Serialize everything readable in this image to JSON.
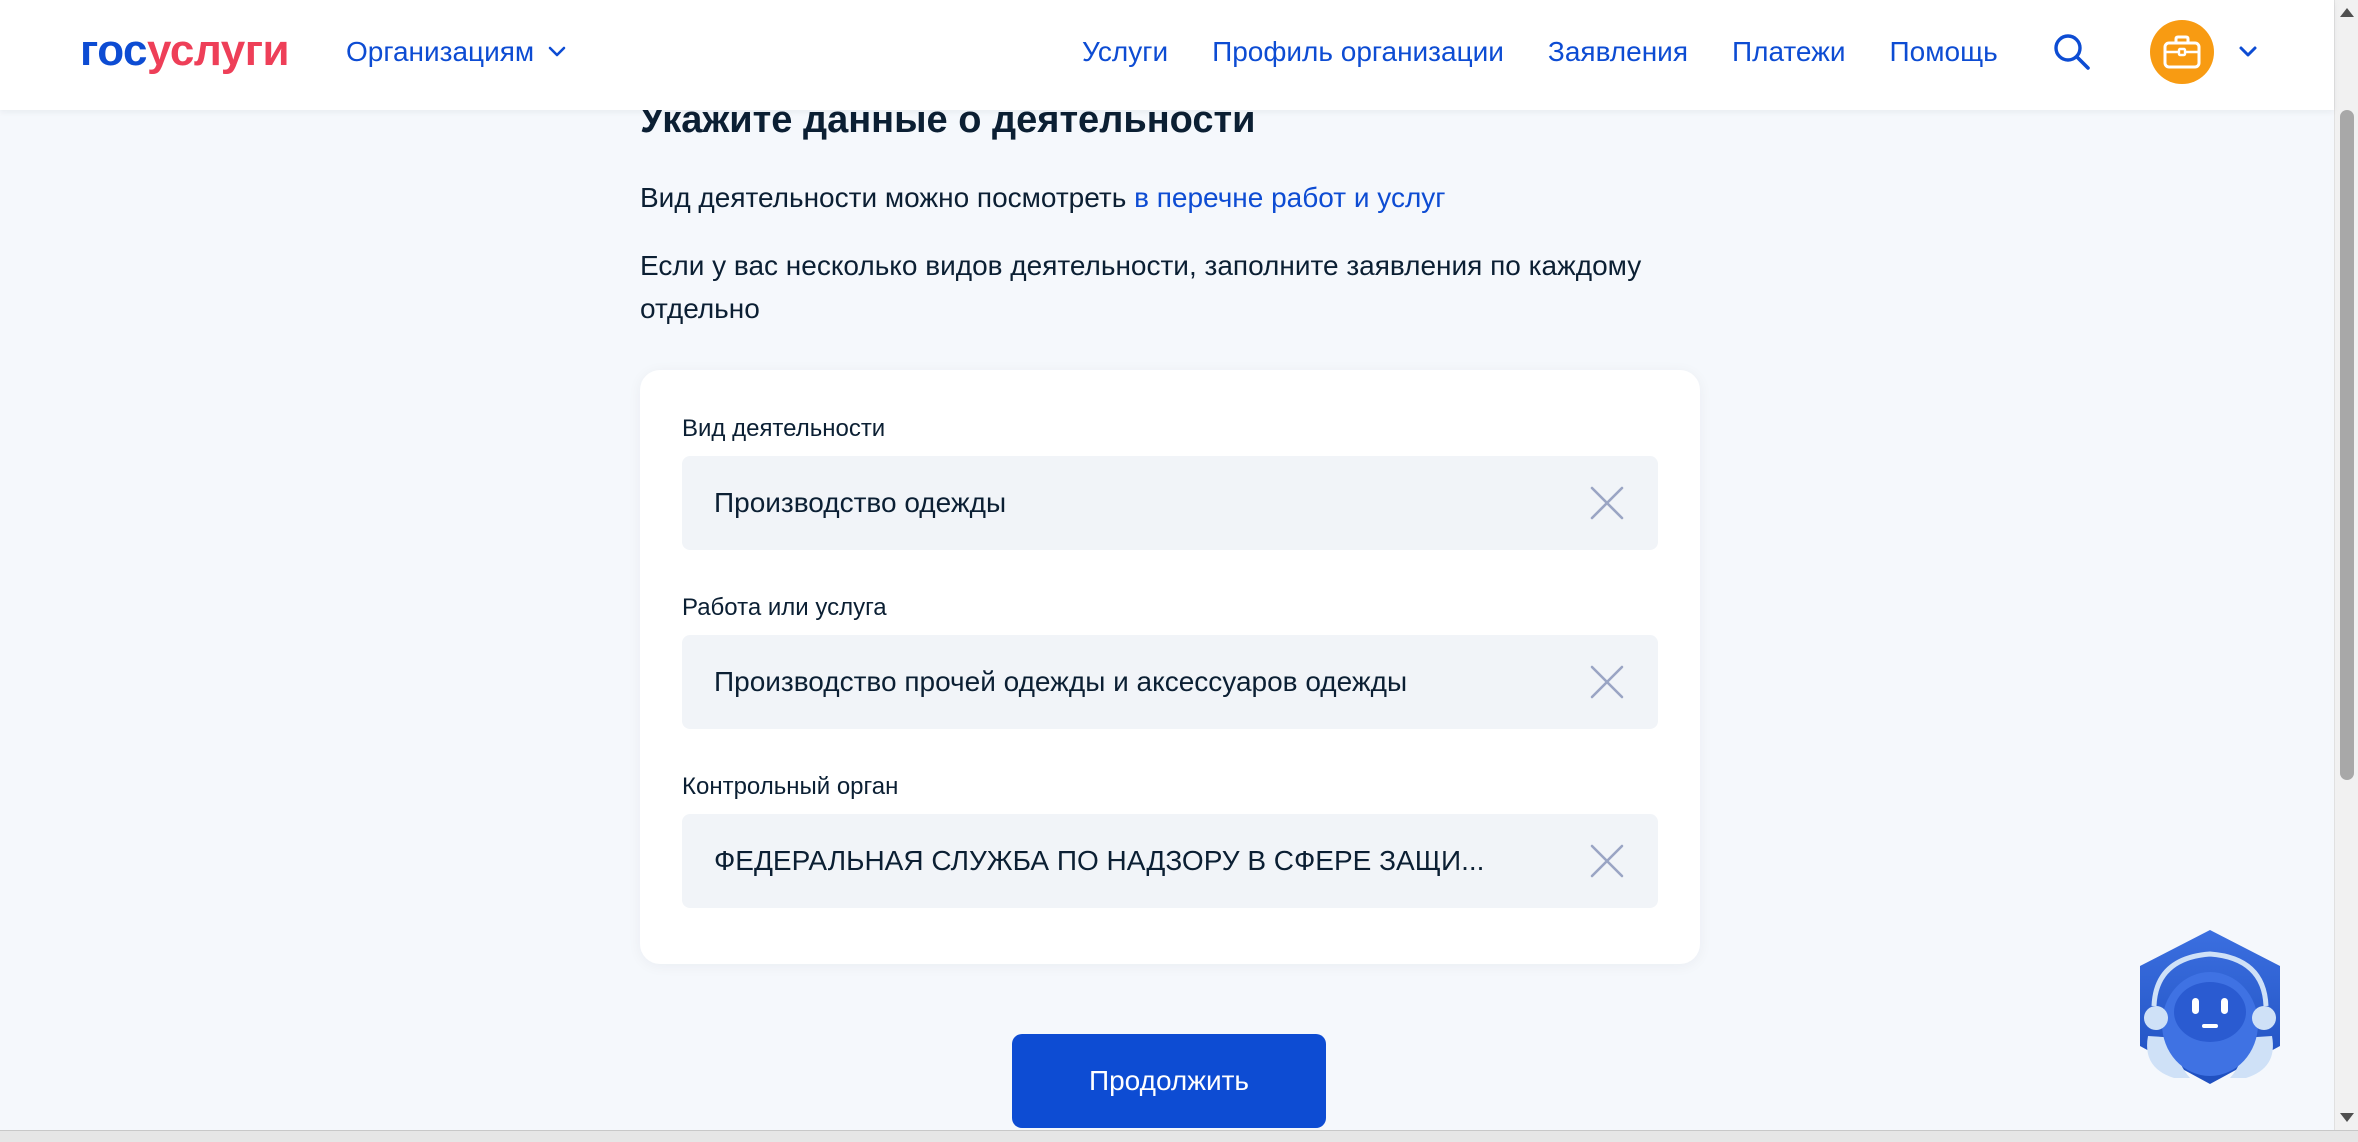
{
  "header": {
    "logo_part1": "гос",
    "logo_part2": "услуги",
    "org_menu_label": "Организациям",
    "nav": [
      {
        "label": "Услуги"
      },
      {
        "label": "Профиль организации"
      },
      {
        "label": "Заявления"
      },
      {
        "label": "Платежи"
      },
      {
        "label": "Помощь"
      }
    ],
    "avatar_color": "#f89b12",
    "avatar_icon": "briefcase-icon"
  },
  "main": {
    "title": "Укажите данные о деятельности",
    "intro_text": "Вид деятельности можно посмотреть ",
    "intro_link": "в перечне работ и услуг",
    "note": "Если у вас несколько видов деятельности, заполните заявления по каждому отдельно",
    "fields": [
      {
        "label": "Вид деятельности",
        "value": "Производство одежды"
      },
      {
        "label": "Работа или услуга",
        "value": "Производство прочей одежды и аксессуаров одежды"
      },
      {
        "label": "Контрольный орган",
        "value": "ФЕДЕРАЛЬНАЯ СЛУЖБА ПО НАДЗОРУ В СФЕРЕ ЗАЩИ..."
      }
    ],
    "continue_label": "Продолжить"
  },
  "colors": {
    "accent": "#0d4cd3",
    "brand_red": "#ee3f58",
    "background": "#f5f8fc"
  }
}
